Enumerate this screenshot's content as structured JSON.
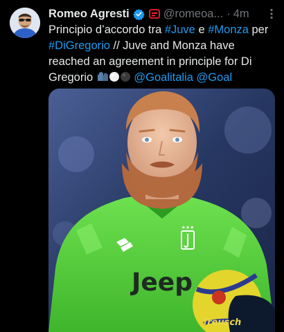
{
  "author": {
    "display_name": "Romeo Agresti",
    "handle": "@romeoa...",
    "verified_icon": "verified-badge-icon",
    "flair_icon": "red-flair-icon"
  },
  "meta": {
    "separator": "·",
    "time": "4m",
    "more_icon": "more-options-icon"
  },
  "text": {
    "t1": "Principio d’accordo tra ",
    "juve": "#Juve",
    "t2": " e ",
    "monza": "#Monza",
    "t3": " per ",
    "digregorio": "#DiGregorio",
    "t4": " // Juve and Monza have reached an agreement in principle for Di Gregorio ",
    "goalitalia": "@Goalitalia",
    "t5": " ",
    "goal": "@Goal"
  },
  "media": {
    "jersey_brand": "Jeep",
    "ball_brand": "Treusch",
    "accent_colors": {
      "shirt": "#57d23f",
      "background": "#2a3a6a",
      "link": "#1d9bf0"
    }
  }
}
